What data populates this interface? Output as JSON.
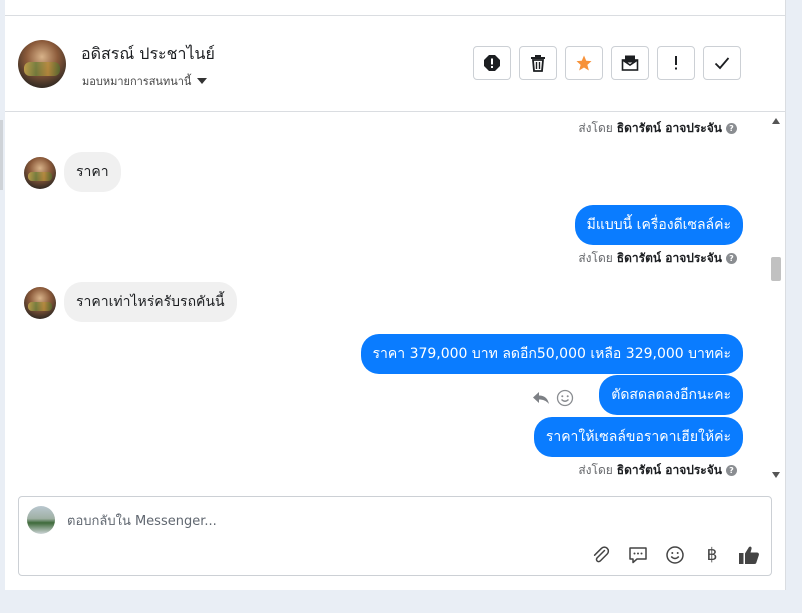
{
  "header": {
    "name": "อดิสรณ์ ประชาไนย์",
    "assign_label": "มอบหมายการสนทนานี้",
    "actions": [
      {
        "icon": "alert-icon",
        "title": "spam"
      },
      {
        "icon": "trash-icon",
        "title": "delete"
      },
      {
        "icon": "star-icon",
        "title": "follow-up"
      },
      {
        "icon": "mail-icon",
        "title": "mark-unread"
      },
      {
        "icon": "exclamation-icon",
        "title": "important"
      },
      {
        "icon": "check-icon",
        "title": "done"
      }
    ]
  },
  "colors": {
    "accent_blue": "#0a7cff",
    "star_orange": "#f7923a",
    "incoming_bubble": "#f0f0f0"
  },
  "sent_by_prefix": "ส่งโดย",
  "sent_by_name": "ธิดารัตน์ อาจประจัน",
  "messages": {
    "in_1": "ราคา",
    "out_1": "มีแบบนี้ เครื่องดีเซลล์ค่ะ",
    "in_2": "ราคาเท่าไหร่ครับรถคันนี้",
    "out_2": "ราคา 379,000 บาท ลดอีก50,000 เหลือ 329,000 บาทค่ะ",
    "out_3": "ตัดสดลดลงอีกนะคะ",
    "out_4": "ราคาให้เซลล์ขอราคาเฮียให้ค่ะ"
  },
  "composer": {
    "placeholder": "ตอบกลับใน Messenger...",
    "tools": [
      "paperclip-icon",
      "speech-bubble-icon",
      "smiley-icon",
      "baht-icon",
      "thumbs-up-icon"
    ],
    "baht_symbol": "฿"
  }
}
